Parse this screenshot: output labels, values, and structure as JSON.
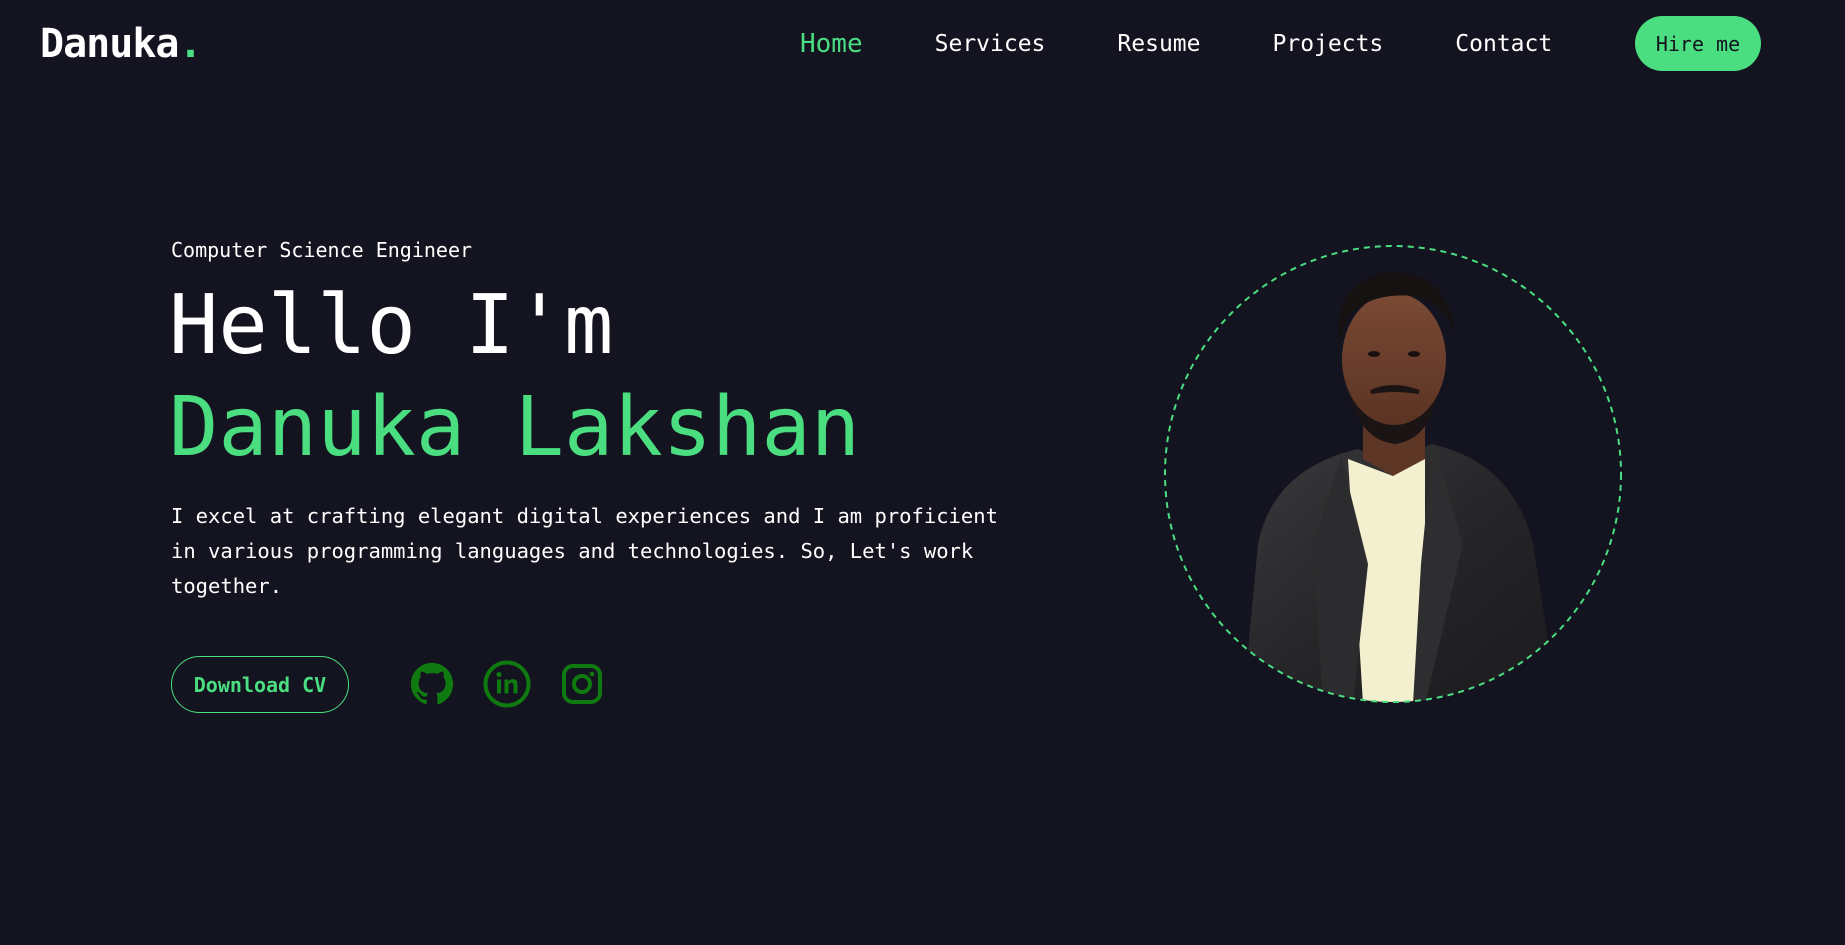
{
  "brand": {
    "name": "Danuka",
    "dot": "."
  },
  "nav": {
    "items": [
      {
        "label": "Home",
        "active": true
      },
      {
        "label": "Services",
        "active": false
      },
      {
        "label": "Resume",
        "active": false
      },
      {
        "label": "Projects",
        "active": false
      },
      {
        "label": "Contact",
        "active": false
      }
    ],
    "hire_label": "Hire me"
  },
  "hero": {
    "subtitle": "Computer Science Engineer",
    "greeting": "Hello I'm",
    "name": "Danuka Lakshan",
    "description": "I excel at crafting elegant digital experiences and I am proficient in various programming languages and technologies. So, Let's work together.",
    "cv_label": "Download CV",
    "socials": [
      {
        "icon": "github-icon"
      },
      {
        "icon": "linkedin-icon"
      },
      {
        "icon": "instagram-icon"
      }
    ]
  },
  "colors": {
    "background": "#13141f",
    "accent": "#4ade80",
    "social_icon": "#0f7a0f",
    "text": "#ffffff"
  }
}
